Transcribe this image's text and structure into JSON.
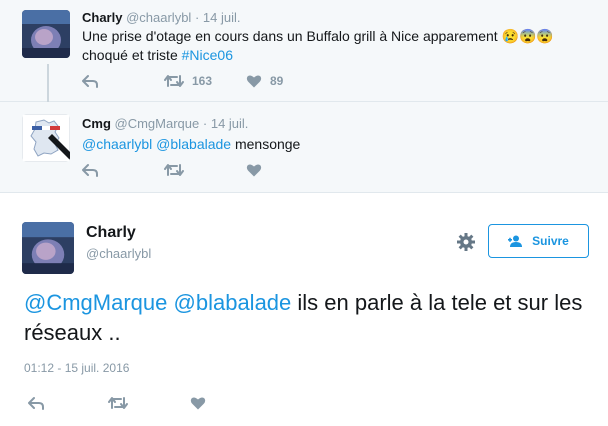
{
  "tweet1": {
    "name": "Charly",
    "handle": "@chaarlybl",
    "sep": "·",
    "date": "14 juil.",
    "text": "Une prise d'otage en cours dans un Buffalo grill à Nice apparement 😢😨😨 choqué et triste",
    "hashtag": "#Nice06",
    "retweets": "163",
    "likes": "89"
  },
  "tweet2": {
    "name": "Cmg",
    "handle": "@CmgMarque",
    "sep": "·",
    "date": "14 juil.",
    "mention1": "@chaarlybl",
    "mention2": "@blabalade",
    "text": "mensonge"
  },
  "main": {
    "name": "Charly",
    "handle": "@chaarlybl",
    "follow_label": "Suivre",
    "mention1": "@CmgMarque",
    "mention2": "@blabalade",
    "text": "ils en parle à la tele et sur les réseaux ..",
    "timestamp": "01:12 - 15 juil. 2016"
  },
  "icons": [
    "reply-icon",
    "retweet-icon",
    "like-icon",
    "gear-icon",
    "follow-user-icon"
  ],
  "colors": {
    "link": "#1b95e0",
    "muted": "#8899a6",
    "context_bg": "#f5f8fa"
  }
}
